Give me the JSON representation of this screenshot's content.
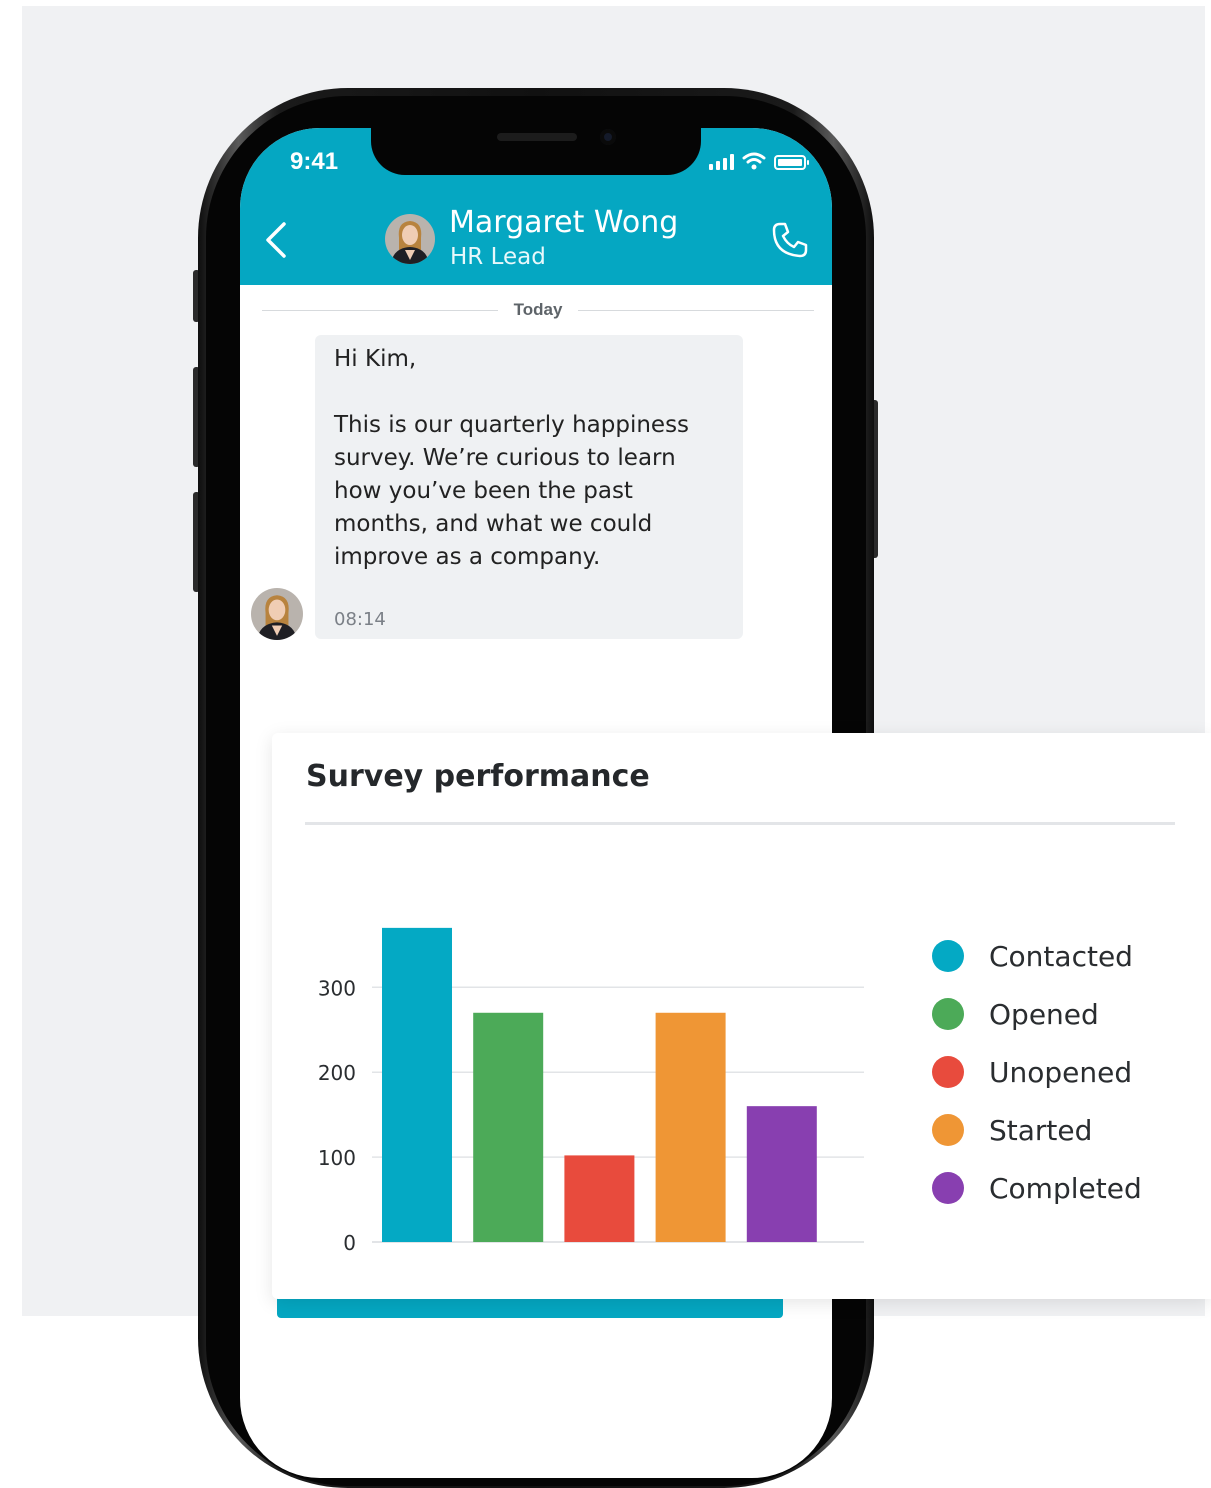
{
  "phone": {
    "status_time": "9:41",
    "header": {
      "contact_name": "Margaret Wong",
      "contact_role": "HR Lead"
    },
    "date_divider": "Today",
    "message": {
      "greeting": "Hi Kim,",
      "body": "This is our quarterly happiness survey. We’re curious to learn how you’ve been the past months, and what we could improve as a company.",
      "time": "08:14"
    },
    "accent_color": "#05a7c2"
  },
  "card": {
    "title": "Survey performance"
  },
  "chart_data": {
    "type": "bar",
    "categories": [
      "Contacted",
      "Opened",
      "Unopened",
      "Started",
      "Completed"
    ],
    "values": [
      370,
      270,
      102,
      270,
      160
    ],
    "colors": [
      "#04a9c4",
      "#4caa58",
      "#e84b3d",
      "#ef9635",
      "#883fb0"
    ],
    "yticks": [
      0,
      100,
      200,
      300
    ],
    "ylim": [
      0,
      370
    ],
    "grid": true,
    "legend_position": "right"
  }
}
